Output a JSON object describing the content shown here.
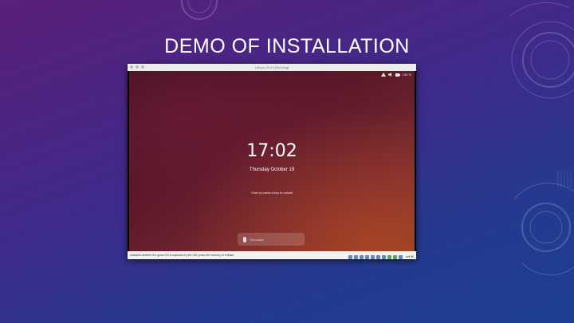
{
  "slide": {
    "title": "DEMO OF INSTALLATION"
  },
  "vm_window": {
    "title": "Ubuntu 23.10 [Running]",
    "lock_screen": {
      "time": "17:02",
      "date": "Thursday October 19",
      "unlock_hint": "Click or press a key to unlock",
      "notification_text": "No music"
    },
    "topbar": {
      "network_icon": "network-icon",
      "volume_icon": "volume-icon",
      "battery_text": "100 %"
    },
    "statusbar": {
      "hint": "Indicates whether the guest OS is captured by the VM; press the host key to release",
      "host_key": "Left ⌘"
    }
  },
  "colors": {
    "slide_bg_top": "#5a1f7a",
    "slide_bg_bottom": "#1d3f93",
    "lock_bg": "#5a1828",
    "lock_glow": "#be501e"
  }
}
